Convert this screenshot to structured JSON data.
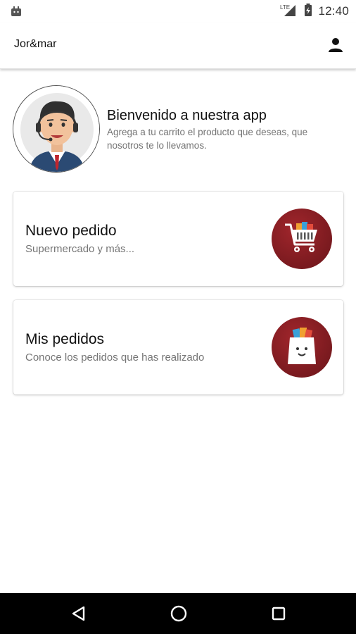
{
  "status_bar": {
    "time": "12:40",
    "network": "LTE",
    "icons": [
      "android-debug-icon",
      "lte-signal-icon",
      "battery-icon"
    ]
  },
  "app_bar": {
    "title": "Jor&mar",
    "profile_icon": "person-icon"
  },
  "welcome": {
    "title": "Bienvenido a nuestra app",
    "subtitle": "Agrega a tu carrito el producto que deseas, que nosotros te lo llevamos.",
    "avatar_icon": "support-agent-avatar"
  },
  "cards": [
    {
      "title": "Nuevo pedido",
      "subtitle": "Supermercado y más...",
      "icon": "shopping-cart-icon"
    },
    {
      "title": "Mis pedidos",
      "subtitle": "Conoce los pedidos que has realizado",
      "icon": "shopping-bag-icon"
    }
  ],
  "colors": {
    "accent": "#8b1e24",
    "text_primary": "#111111",
    "text_secondary": "#757575",
    "nav_bar": "#000000"
  },
  "nav_bar": {
    "icons": [
      "back-triangle-icon",
      "home-circle-icon",
      "recent-square-icon"
    ]
  }
}
